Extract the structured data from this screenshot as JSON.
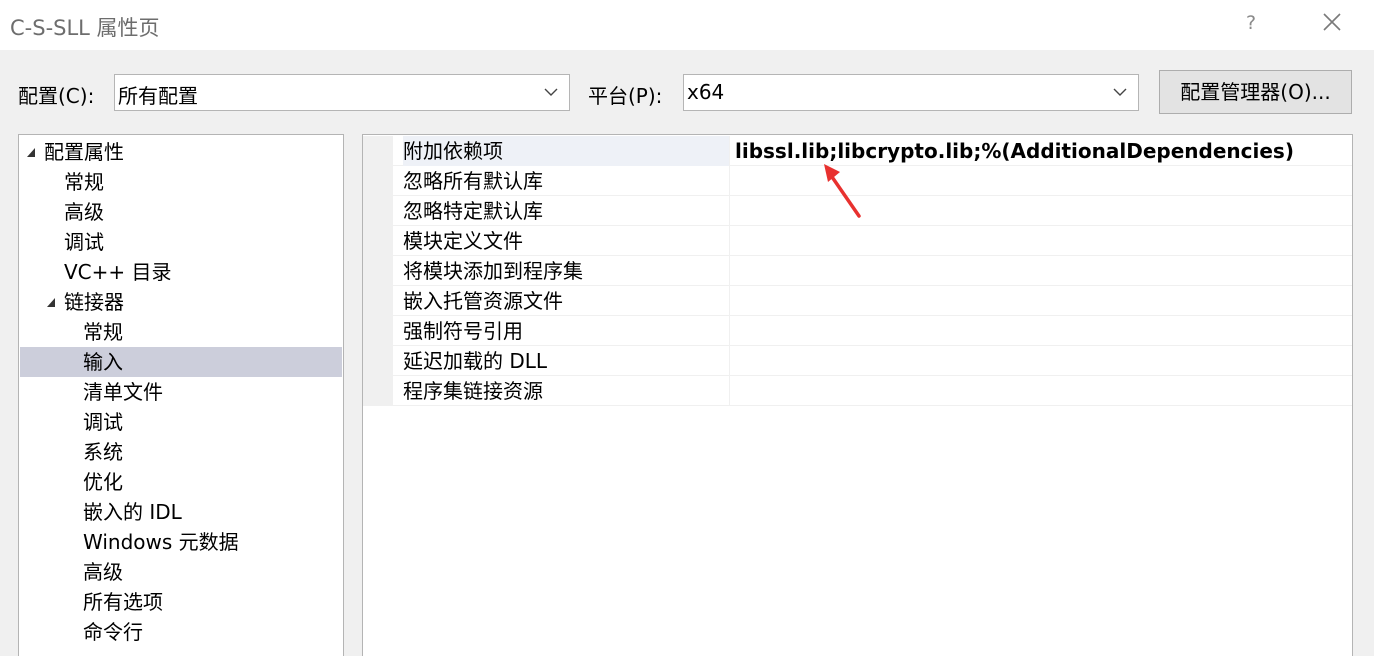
{
  "window": {
    "title": "C-S-SLL 属性页",
    "help_label": "?",
    "close_icon": "close-icon"
  },
  "toolbar": {
    "config_label": "配置(C):",
    "config_value": "所有配置",
    "platform_label": "平台(P):",
    "platform_value": "x64",
    "manager_button": "配置管理器(O)..."
  },
  "tree": {
    "items": [
      {
        "label": "配置属性",
        "level": 0,
        "expanded": true,
        "selected": false
      },
      {
        "label": "常规",
        "level": 1,
        "selected": false
      },
      {
        "label": "高级",
        "level": 1,
        "selected": false
      },
      {
        "label": "调试",
        "level": 1,
        "selected": false
      },
      {
        "label": "VC++ 目录",
        "level": 1,
        "selected": false
      },
      {
        "label": "链接器",
        "level": 1,
        "expanded": true,
        "selected": false
      },
      {
        "label": "常规",
        "level": 2,
        "selected": false
      },
      {
        "label": "输入",
        "level": 2,
        "selected": true
      },
      {
        "label": "清单文件",
        "level": 2,
        "selected": false
      },
      {
        "label": "调试",
        "level": 2,
        "selected": false
      },
      {
        "label": "系统",
        "level": 2,
        "selected": false
      },
      {
        "label": "优化",
        "level": 2,
        "selected": false
      },
      {
        "label": "嵌入的 IDL",
        "level": 2,
        "selected": false
      },
      {
        "label": "Windows 元数据",
        "level": 2,
        "selected": false
      },
      {
        "label": "高级",
        "level": 2,
        "selected": false
      },
      {
        "label": "所有选项",
        "level": 2,
        "selected": false
      },
      {
        "label": "命令行",
        "level": 2,
        "selected": false
      }
    ]
  },
  "properties": {
    "rows": [
      {
        "name": "附加依赖项",
        "value": "libssl.lib;libcrypto.lib;%(AdditionalDependencies)"
      },
      {
        "name": "忽略所有默认库",
        "value": ""
      },
      {
        "name": "忽略特定默认库",
        "value": ""
      },
      {
        "name": "模块定义文件",
        "value": ""
      },
      {
        "name": "将模块添加到程序集",
        "value": ""
      },
      {
        "name": "嵌入托管资源文件",
        "value": ""
      },
      {
        "name": "强制符号引用",
        "value": ""
      },
      {
        "name": "延迟加载的 DLL",
        "value": ""
      },
      {
        "name": "程序集链接资源",
        "value": ""
      }
    ]
  },
  "annotation": {
    "arrow_color": "#e8312f"
  }
}
